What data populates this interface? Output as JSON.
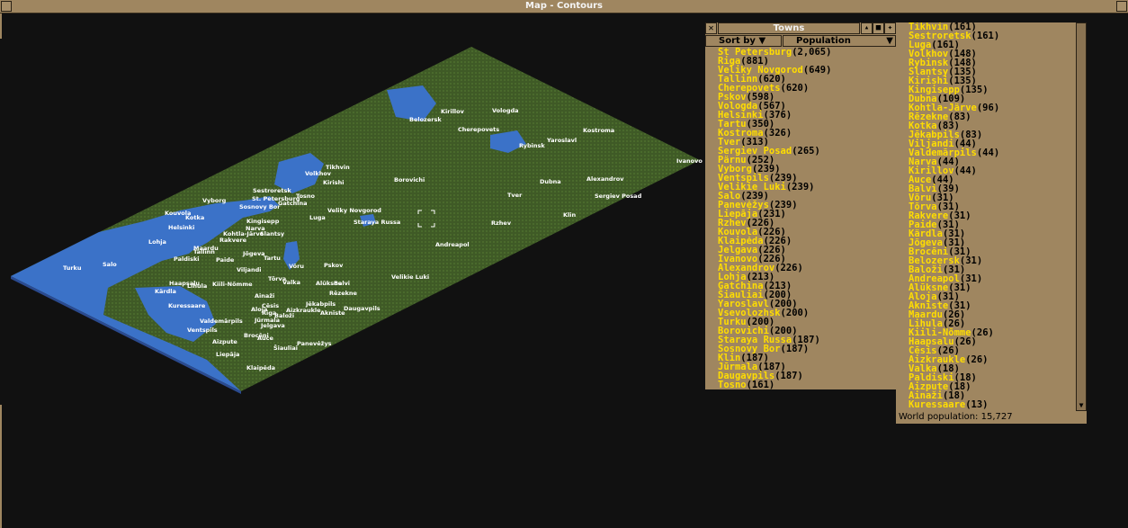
{
  "window": {
    "title": "Map - Contours"
  },
  "towns_window": {
    "title": "Towns",
    "sort_by_label": "Sort by",
    "sort_criteria": "Population",
    "world_population": "World population: 15,727"
  },
  "towns_left": [
    {
      "name": "St Petersburg",
      "pop": "(2,065)"
    },
    {
      "name": "Riga",
      "pop": "(881)"
    },
    {
      "name": "Veliky Novgorod",
      "pop": "(649)"
    },
    {
      "name": "Tallinn",
      "pop": "(620)"
    },
    {
      "name": "Cherepovets",
      "pop": "(620)"
    },
    {
      "name": "Pskov",
      "pop": "(598)"
    },
    {
      "name": "Vologda",
      "pop": "(567)"
    },
    {
      "name": "Helsinki",
      "pop": "(376)"
    },
    {
      "name": "Tartu",
      "pop": "(350)"
    },
    {
      "name": "Kostroma",
      "pop": "(326)"
    },
    {
      "name": "Tver",
      "pop": "(313)"
    },
    {
      "name": "Sergiev Posad",
      "pop": "(265)"
    },
    {
      "name": "Pärnu",
      "pop": "(252)"
    },
    {
      "name": "Vyborg",
      "pop": "(239)"
    },
    {
      "name": "Ventspils",
      "pop": "(239)"
    },
    {
      "name": "Velikie Luki",
      "pop": "(239)"
    },
    {
      "name": "Salo",
      "pop": "(239)"
    },
    {
      "name": "Panevėžys",
      "pop": "(239)"
    },
    {
      "name": "Liepāja",
      "pop": "(231)"
    },
    {
      "name": "Rzhev",
      "pop": "(226)"
    },
    {
      "name": "Kouvola",
      "pop": "(226)"
    },
    {
      "name": "Klaipėda",
      "pop": "(226)"
    },
    {
      "name": "Jelgava",
      "pop": "(226)"
    },
    {
      "name": "Ivanovo",
      "pop": "(226)"
    },
    {
      "name": "Alexandrov",
      "pop": "(226)"
    },
    {
      "name": "Lohja",
      "pop": "(213)"
    },
    {
      "name": "Gatchina",
      "pop": "(213)"
    },
    {
      "name": "Šiauliai",
      "pop": "(200)"
    },
    {
      "name": "Yaroslavl",
      "pop": "(200)"
    },
    {
      "name": "Vsevolozhsk",
      "pop": "(200)"
    },
    {
      "name": "Turku",
      "pop": "(200)"
    },
    {
      "name": "Borovichi",
      "pop": "(200)"
    },
    {
      "name": "Staraya Russa",
      "pop": "(187)"
    },
    {
      "name": "Sosnovy Bor",
      "pop": "(187)"
    },
    {
      "name": "Klin",
      "pop": "(187)"
    },
    {
      "name": "Jūrmala",
      "pop": "(187)"
    },
    {
      "name": "Daugavpils",
      "pop": "(187)"
    },
    {
      "name": "Tosno",
      "pop": "(161)"
    }
  ],
  "towns_right": [
    {
      "name": "Tikhvin",
      "pop": "(161)"
    },
    {
      "name": "Sestroretsk",
      "pop": "(161)"
    },
    {
      "name": "Luga",
      "pop": "(161)"
    },
    {
      "name": "Volkhov",
      "pop": "(148)"
    },
    {
      "name": "Rybinsk",
      "pop": "(148)"
    },
    {
      "name": "Slantsy",
      "pop": "(135)"
    },
    {
      "name": "Kirishi",
      "pop": "(135)"
    },
    {
      "name": "Kingisepp",
      "pop": "(135)"
    },
    {
      "name": "Dubna",
      "pop": "(109)"
    },
    {
      "name": "Kohtla-Järve",
      "pop": "(96)"
    },
    {
      "name": "Rēzekne",
      "pop": "(83)"
    },
    {
      "name": "Kotka",
      "pop": "(83)"
    },
    {
      "name": "Jēkabpils",
      "pop": "(83)"
    },
    {
      "name": "Viljandi",
      "pop": "(44)"
    },
    {
      "name": "Valdemārpils",
      "pop": "(44)"
    },
    {
      "name": "Narva",
      "pop": "(44)"
    },
    {
      "name": "Kirillov",
      "pop": "(44)"
    },
    {
      "name": "Auce",
      "pop": "(44)"
    },
    {
      "name": "Balvi",
      "pop": "(39)"
    },
    {
      "name": "Võru",
      "pop": "(31)"
    },
    {
      "name": "Tõrva",
      "pop": "(31)"
    },
    {
      "name": "Rakvere",
      "pop": "(31)"
    },
    {
      "name": "Paide",
      "pop": "(31)"
    },
    {
      "name": "Kärdla",
      "pop": "(31)"
    },
    {
      "name": "Jõgeva",
      "pop": "(31)"
    },
    {
      "name": "Brocēni",
      "pop": "(31)"
    },
    {
      "name": "Belozersk",
      "pop": "(31)"
    },
    {
      "name": "Baloži",
      "pop": "(31)"
    },
    {
      "name": "Andreapol",
      "pop": "(31)"
    },
    {
      "name": "Alūksne",
      "pop": "(31)"
    },
    {
      "name": "Aloja",
      "pop": "(31)"
    },
    {
      "name": "Aknīste",
      "pop": "(31)"
    },
    {
      "name": "Maardu",
      "pop": "(26)"
    },
    {
      "name": "Lihula",
      "pop": "(26)"
    },
    {
      "name": "Kiili-Nõmme",
      "pop": "(26)"
    },
    {
      "name": "Haapsalu",
      "pop": "(26)"
    },
    {
      "name": "Cēsis",
      "pop": "(26)"
    },
    {
      "name": "Aizkraukle",
      "pop": "(26)"
    },
    {
      "name": "Valka",
      "pop": "(18)"
    },
    {
      "name": "Paldiski",
      "pop": "(18)"
    },
    {
      "name": "Aizpute",
      "pop": "(18)"
    },
    {
      "name": "Ainaži",
      "pop": "(18)"
    },
    {
      "name": "Kuressaare",
      "pop": "(13)"
    }
  ],
  "map_labels": [
    {
      "text": "Kirillov"
    },
    {
      "text": "Vologda"
    },
    {
      "text": "Belozersk"
    },
    {
      "text": "Cherepovets"
    },
    {
      "text": "Kostroma"
    },
    {
      "text": "Rybinsk"
    },
    {
      "text": "Yaroslavl"
    },
    {
      "text": "Ivanovo"
    },
    {
      "text": "Tikhvin"
    },
    {
      "text": "Volkhov"
    },
    {
      "text": "Kirishi"
    },
    {
      "text": "Borovichi"
    },
    {
      "text": "Dubna"
    },
    {
      "text": "Alexandrov"
    },
    {
      "text": "Sergiev Posad"
    },
    {
      "text": "Tver"
    },
    {
      "text": "Klin"
    },
    {
      "text": "Vyborg"
    },
    {
      "text": "Sestroretsk"
    },
    {
      "text": "St. Petersburg"
    },
    {
      "text": "Sosnovy Bor"
    },
    {
      "text": "Tosno"
    },
    {
      "text": "Gatchina"
    },
    {
      "text": "Kouvola"
    },
    {
      "text": "Kotka"
    },
    {
      "text": "Helsinki"
    },
    {
      "text": "Kingisepp"
    },
    {
      "text": "Narva"
    },
    {
      "text": "Luga"
    },
    {
      "text": "Veliky Novgorod"
    },
    {
      "text": "Staraya Russa"
    },
    {
      "text": "Rzhev"
    },
    {
      "text": "Lohja"
    },
    {
      "text": "Rakvere"
    },
    {
      "text": "Kohtla-Järve"
    },
    {
      "text": "Slantsy"
    },
    {
      "text": "Andreapol"
    },
    {
      "text": "Turku"
    },
    {
      "text": "Salo"
    },
    {
      "text": "Maardu"
    },
    {
      "text": "Tallinn"
    },
    {
      "text": "Paldiski"
    },
    {
      "text": "Paide"
    },
    {
      "text": "Jõgeva"
    },
    {
      "text": "Tartu"
    },
    {
      "text": "Viljandi"
    },
    {
      "text": "Võru"
    },
    {
      "text": "Pskov"
    },
    {
      "text": "Haapsalu"
    },
    {
      "text": "Lihula"
    },
    {
      "text": "Kiili-Nõmme"
    },
    {
      "text": "Tõrva"
    },
    {
      "text": "Valka"
    },
    {
      "text": "Alūksne"
    },
    {
      "text": "Balvi"
    },
    {
      "text": "Velikie Luki"
    },
    {
      "text": "Kärdla"
    },
    {
      "text": "Ainaži"
    },
    {
      "text": "Aloja"
    },
    {
      "text": "Rēzekne"
    },
    {
      "text": "Kuressaare"
    },
    {
      "text": "Cēsis"
    },
    {
      "text": "Jēkabpils"
    },
    {
      "text": "Riga"
    },
    {
      "text": "Aizkraukle"
    },
    {
      "text": "Aknīste"
    },
    {
      "text": "Daugavpils"
    },
    {
      "text": "Jūrmala"
    },
    {
      "text": "Baloži"
    },
    {
      "text": "Valdemārpils"
    },
    {
      "text": "Jelgava"
    },
    {
      "text": "Ventspils"
    },
    {
      "text": "Aizpute"
    },
    {
      "text": "Brocēni"
    },
    {
      "text": "Auce"
    },
    {
      "text": "Šiauliai"
    },
    {
      "text": "Panevėžys"
    },
    {
      "text": "Liepāja"
    },
    {
      "text": "Klaipėda"
    }
  ],
  "colors": {
    "frame": "#9f8660",
    "land": "#3f5a26",
    "water": "#3b72c8",
    "town_name": "#ffdd00"
  }
}
